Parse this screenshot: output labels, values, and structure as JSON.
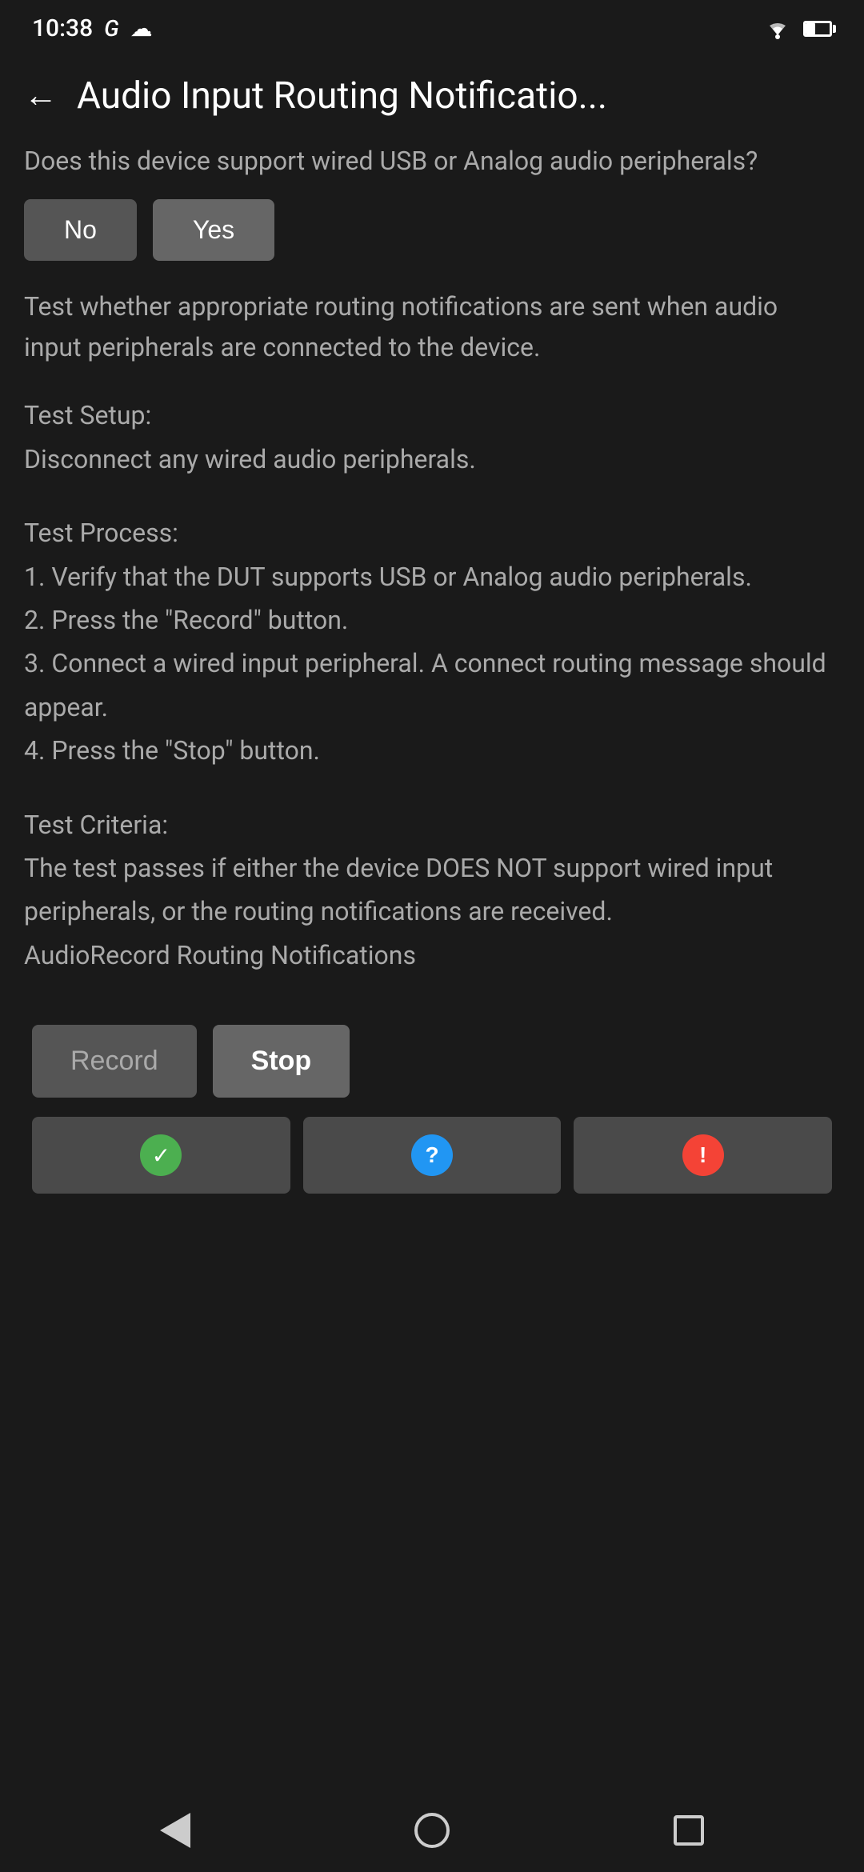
{
  "statusBar": {
    "time": "10:38",
    "googleIcon": "G",
    "cloudIcon": "☁"
  },
  "header": {
    "backLabel": "←",
    "title": "Audio Input Routing Notificatio..."
  },
  "content": {
    "questionText": "Does this device support wired USB or Analog audio peripherals?",
    "noButtonLabel": "No",
    "yesButtonLabel": "Yes",
    "descriptionText": "Test whether appropriate routing notifications are sent when audio input peripherals are connected to the device.",
    "testSetupTitle": "Test Setup:",
    "testSetupBody": "Disconnect any wired audio peripherals.",
    "testProcessTitle": "Test Process:",
    "testProcessStep1": "1. Verify that the DUT supports USB or Analog audio peripherals.",
    "testProcessStep2": "2. Press the \"Record\" button.",
    "testProcessStep3": "3. Connect a wired input peripheral. A connect routing message should appear.",
    "testProcessStep4": "4. Press the \"Stop\" button.",
    "testCriteriaTitle": "Test Criteria:",
    "testCriteriaBody": "The test passes if either the device DOES NOT support wired input peripherals, or the routing notifications are received.",
    "testCriteriaName": "AudioRecord Routing Notifications"
  },
  "actions": {
    "recordButtonLabel": "Record",
    "stopButtonLabel": "Stop"
  },
  "results": {
    "passIcon": "✓",
    "questionIcon": "?",
    "failIcon": "!"
  },
  "navBar": {
    "backIcon": "back",
    "homeIcon": "home",
    "recentIcon": "recent"
  }
}
